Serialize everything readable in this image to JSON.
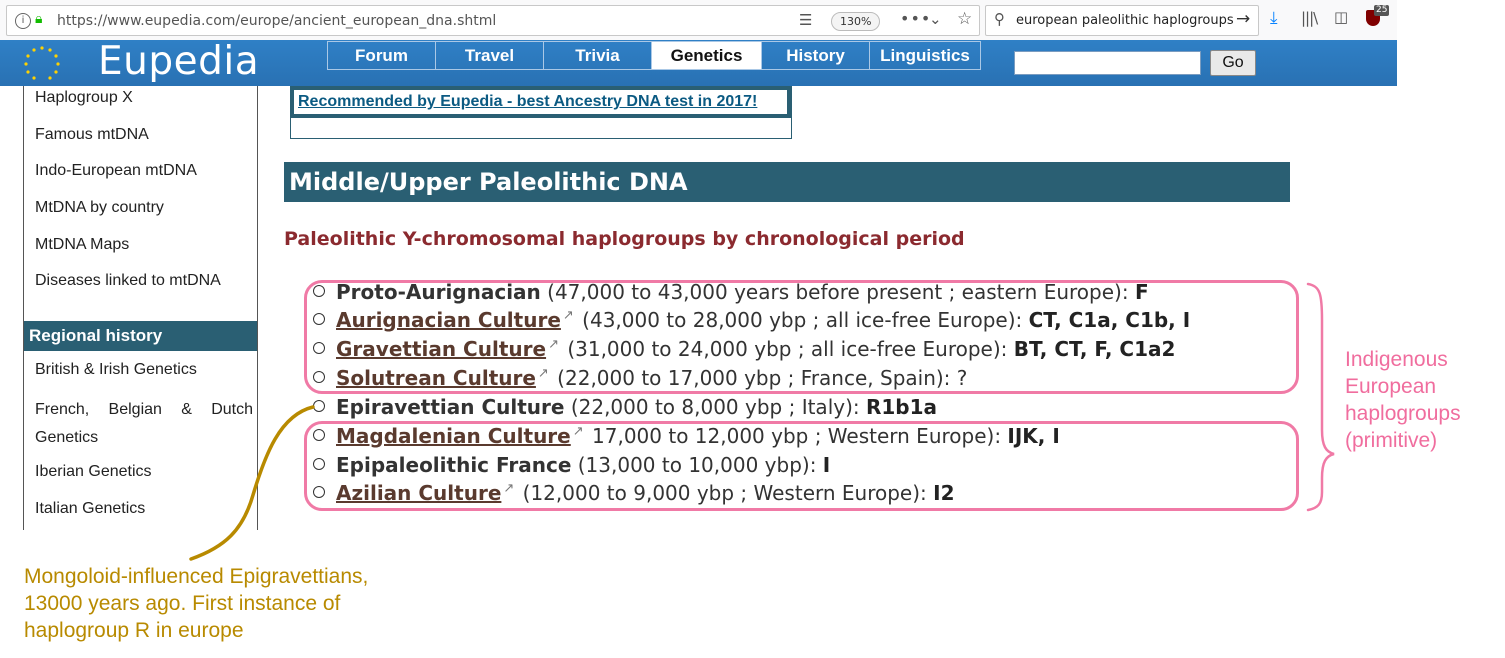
{
  "browser": {
    "url": "https://www.eupedia.com/europe/ancient_european_dna.shtml",
    "zoom": "130%",
    "search_query": "european paleolithic haplogroups",
    "ublock_count": "25"
  },
  "site": {
    "logo": "Eupedia",
    "nav": [
      "Forum",
      "Travel",
      "Trivia",
      "Genetics",
      "History",
      "Linguistics"
    ],
    "active_nav": "Genetics",
    "search_button": "Go"
  },
  "sidebar": {
    "links": [
      "Haplogroup X",
      "Famous mtDNA",
      "Indo-European mtDNA",
      "MtDNA by country",
      "MtDNA Maps",
      "Diseases linked to mtDNA"
    ],
    "regional_header": "Regional history",
    "regional_links": [
      "British & Irish Genetics",
      "French, Belgian & Dutch Genetics",
      "Iberian Genetics",
      "Italian Genetics"
    ]
  },
  "main": {
    "recommended_link": "Recommended by Eupedia - best Ancestry DNA test in 2017!",
    "section_heading": "Middle/Upper Paleolithic DNA",
    "subheading": "Paleolithic Y-chromosomal haplogroups by chronological period",
    "periods": [
      {
        "name": "Proto-Aurignacian",
        "linked": false,
        "desc": " (47,000 to 43,000 years before present ; eastern Europe): ",
        "haplogroups": "F"
      },
      {
        "name": "Aurignacian Culture",
        "linked": true,
        "desc": " (43,000 to 28,000 ybp ; all ice-free Europe): ",
        "haplogroups": "CT, C1a, C1b, I"
      },
      {
        "name": "Gravettian Culture",
        "linked": true,
        "desc": " (31,000 to 24,000 ybp ; all ice-free Europe): ",
        "haplogroups": "BT, CT, F, C1a2"
      },
      {
        "name": "Solutrean Culture",
        "linked": true,
        "desc": " (22,000 to 17,000 ybp ; France, Spain): ?",
        "haplogroups": ""
      },
      {
        "name": "Epiravettian Culture",
        "linked": false,
        "desc": " (22,000 to 8,000 ybp ; Italy): ",
        "haplogroups": "R1b1a"
      },
      {
        "name": "Magdalenian Culture",
        "linked": true,
        "desc": " 17,000 to 12,000 ybp ; Western Europe): ",
        "haplogroups": "IJK, I"
      },
      {
        "name": "Epipaleolithic France",
        "linked": false,
        "desc": " (13,000 to 10,000 ybp): ",
        "haplogroups": "I"
      },
      {
        "name": "Azilian Culture",
        "linked": true,
        "desc": " (12,000 to 9,000 ybp ; Western Europe): ",
        "haplogroups": "I2"
      }
    ]
  },
  "annotations": {
    "pink_note": [
      "Indigenous",
      "European",
      "haplogroups",
      "(primitive)"
    ],
    "olive_note": [
      "Mongoloid-influenced Epigravettians,",
      "13000 years ago.  First instance of",
      "haplogroup R in europe"
    ],
    "pink_color": "#f07aa6",
    "olive_color": "#b88a00"
  }
}
